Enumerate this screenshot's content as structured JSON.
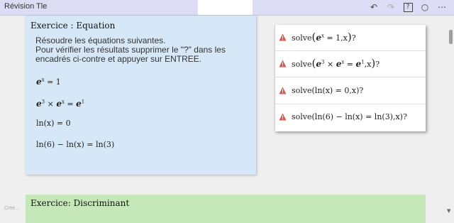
{
  "window": {
    "title": "Révision Tle"
  },
  "toolbar": {
    "undo": "↶",
    "redo": "↷",
    "help": "?",
    "view": "○",
    "more": "⋯"
  },
  "card1": {
    "title": "Exercice : Equation",
    "instructions": [
      "Résoudre les équations suivantes.",
      "Pour vérifier les résultats supprimer le \"?\" dans les",
      "encadrés ci-contre et appuyer sur ENTREE."
    ],
    "equations": {
      "eq1_base": "e",
      "eq1_exp": "x",
      "eq1_rest": " = 1",
      "eq2_base": "e",
      "eq2_exp": "3",
      "eq2_mid": " × ",
      "eq2_base2": "e",
      "eq2_exp2": "x",
      "eq2_eq": " = ",
      "eq2_base3": "e",
      "eq2_exp3": "1",
      "eq3": "ln(x) = 0",
      "eq4": "ln(6) − ln(x) = ln(3)"
    }
  },
  "solve_panel": {
    "rows": [
      {
        "pre": "solve",
        "open": "(",
        "base": "e",
        "exp": "x",
        "rest": " = 1,x",
        "close": ")",
        "q": "?"
      },
      {
        "pre": "solve",
        "open": "(",
        "base": "e",
        "exp": "3",
        "mid": " × ",
        "base2": "e",
        "exp2": "x",
        "eq": " = ",
        "base3": "e",
        "exp3": "1",
        "rest": ",x",
        "close": ")",
        "q": "?"
      },
      {
        "text": "solve(ln(x) = 0,x)?"
      },
      {
        "text": "solve(ln(6) − ln(x) = ln(3),x)?"
      }
    ],
    "warn_color": "#d9534f"
  },
  "card2": {
    "title": "Exercice: Discriminant"
  },
  "credit": "Créé..."
}
